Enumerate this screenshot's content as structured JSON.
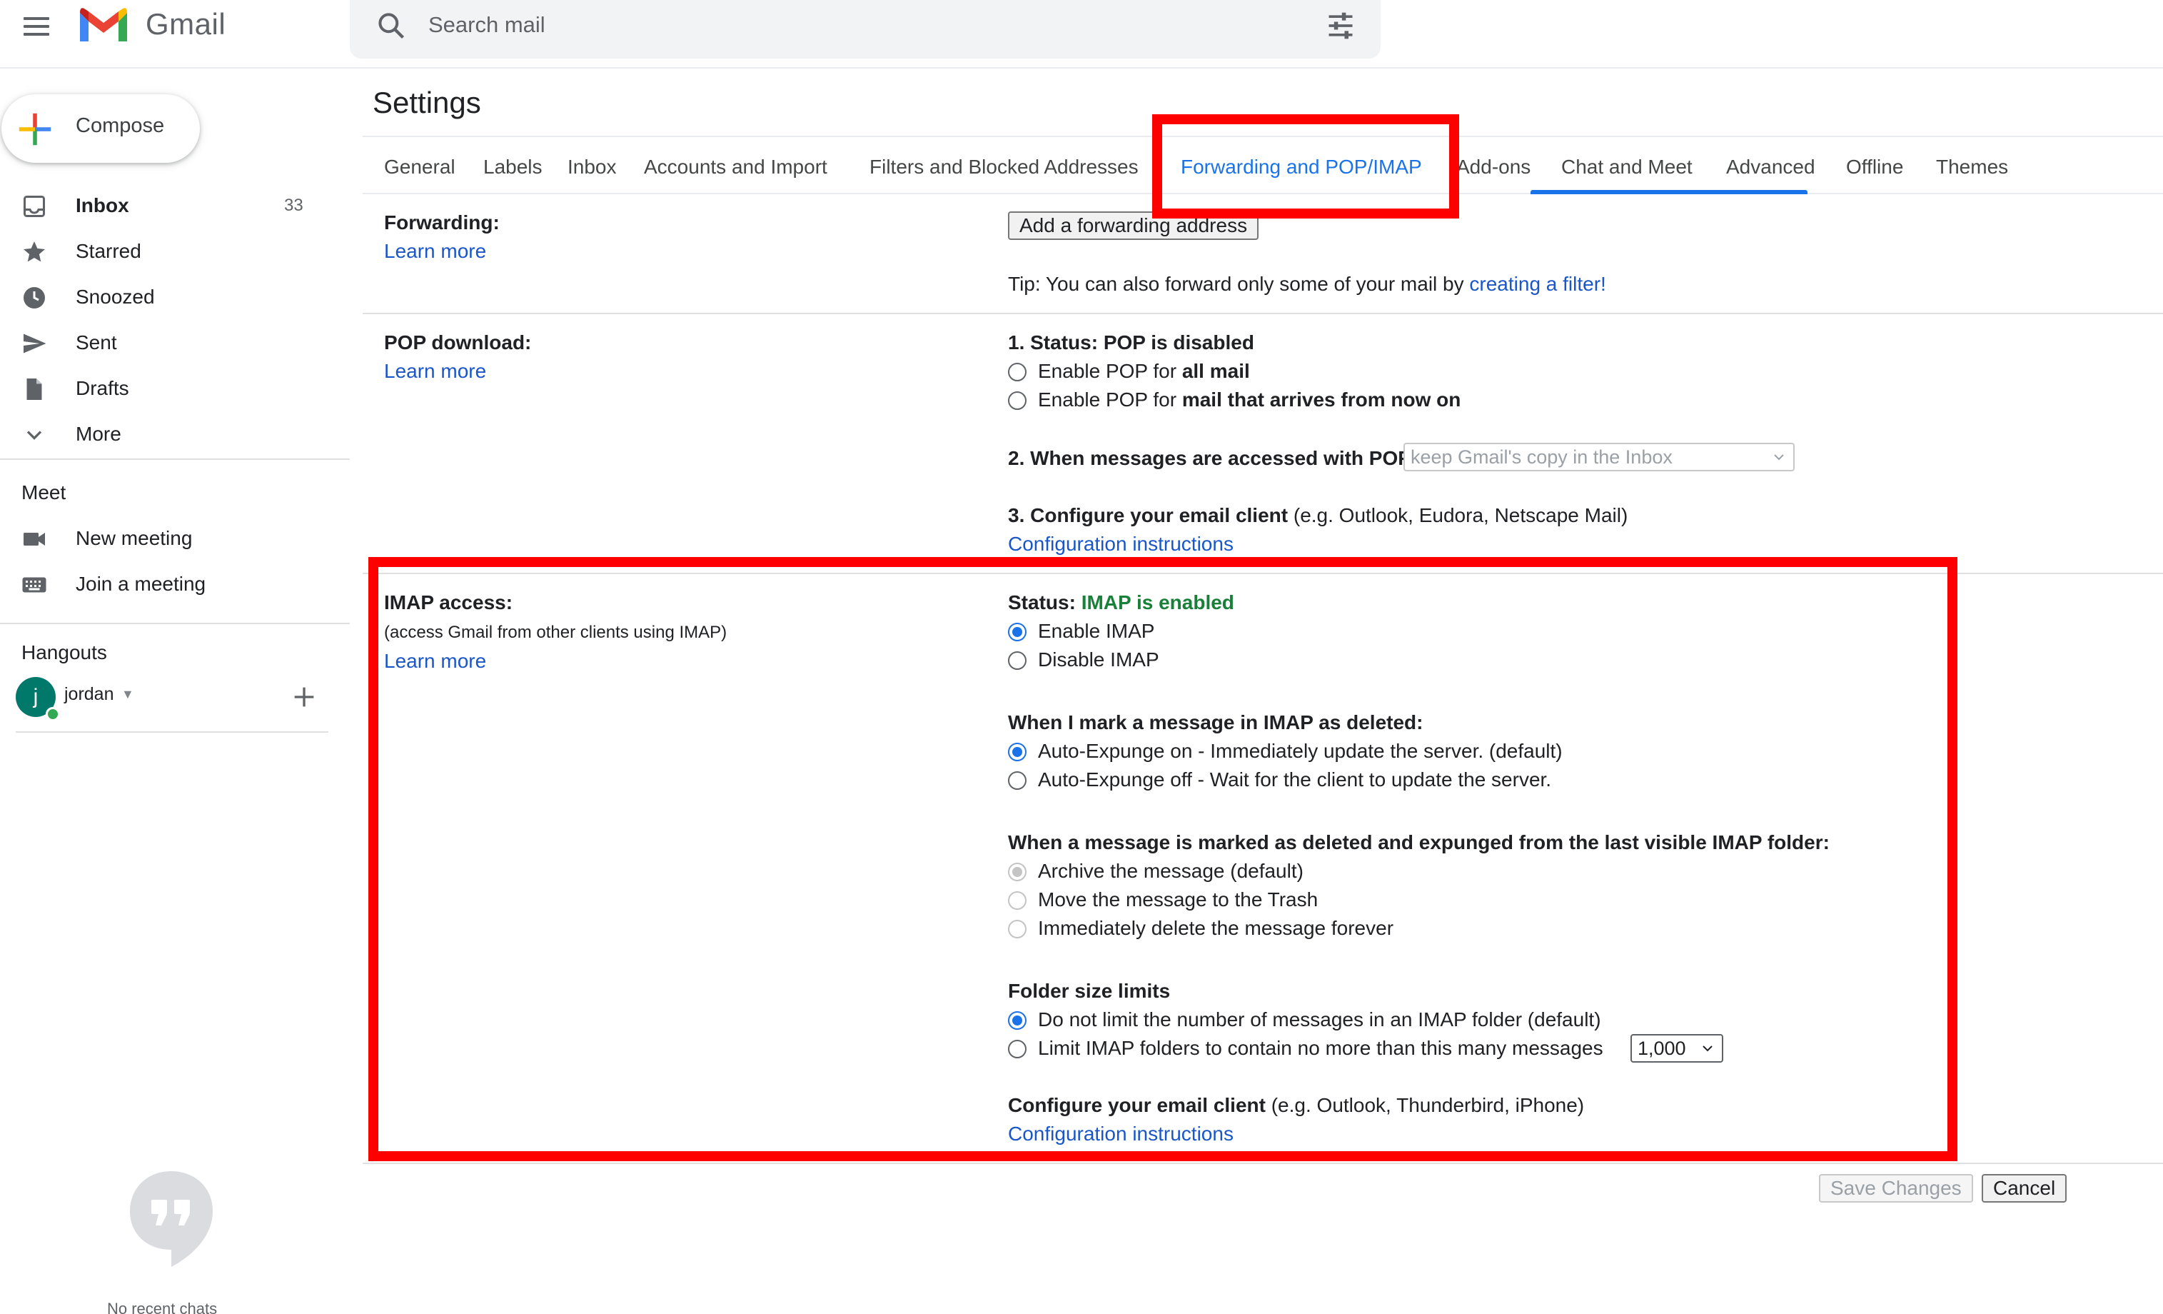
{
  "app": {
    "name": "Gmail"
  },
  "search": {
    "placeholder": "Search mail"
  },
  "sidebar": {
    "compose_label": "Compose",
    "items": [
      {
        "label": "Inbox",
        "count": "33",
        "icon": "inbox-icon"
      },
      {
        "label": "Starred",
        "icon": "star-icon"
      },
      {
        "label": "Snoozed",
        "icon": "clock-icon"
      },
      {
        "label": "Sent",
        "icon": "send-icon"
      },
      {
        "label": "Drafts",
        "icon": "draft-icon"
      },
      {
        "label": "More",
        "icon": "chevron-down-icon"
      }
    ],
    "meet": {
      "title": "Meet",
      "items": [
        {
          "label": "New meeting",
          "icon": "video-icon"
        },
        {
          "label": "Join a meeting",
          "icon": "keyboard-icon"
        }
      ]
    },
    "hangouts": {
      "title": "Hangouts",
      "user_initial": "j",
      "user_name": "jordan",
      "no_chats": "No recent chats"
    }
  },
  "settings": {
    "title": "Settings",
    "tabs": [
      "General",
      "Labels",
      "Inbox",
      "Accounts and Import",
      "Filters and Blocked Addresses",
      "Forwarding and POP/IMAP",
      "Add-ons",
      "Chat and Meet",
      "Advanced",
      "Offline",
      "Themes"
    ],
    "active_tab": "Forwarding and POP/IMAP",
    "learn_more": "Learn more",
    "forwarding": {
      "label": "Forwarding:",
      "button": "Add a forwarding address",
      "tip_prefix": "Tip: You can also forward only some of your mail by ",
      "tip_link": "creating a filter!"
    },
    "pop": {
      "label": "POP download:",
      "status_prefix": "1. Status: ",
      "status_value": "POP is disabled",
      "option1_prefix": "Enable POP for ",
      "option1_bold": "all mail",
      "option2_prefix": "Enable POP for ",
      "option2_bold": "mail that arrives from now on",
      "when_label": "2. When messages are accessed with POP",
      "when_select": "keep Gmail's copy in the Inbox",
      "configure_bold": "3. Configure your email client",
      "configure_rest": " (e.g. Outlook, Eudora, Netscape Mail)",
      "config_link": "Configuration instructions"
    },
    "imap": {
      "label": "IMAP access:",
      "sublabel": "(access Gmail from other clients using IMAP)",
      "status_prefix": "Status: ",
      "status_value": "IMAP is enabled",
      "enable": "Enable IMAP",
      "disable": "Disable IMAP",
      "deleted_heading": "When I mark a message in IMAP as deleted:",
      "expunge_on": "Auto-Expunge on - Immediately update the server. (default)",
      "expunge_off": "Auto-Expunge off - Wait for the client to update the server.",
      "expunged_heading": "When a message is marked as deleted and expunged from the last visible IMAP folder:",
      "archive": "Archive the message (default)",
      "trash": "Move the message to the Trash",
      "delete_forever": "Immediately delete the message forever",
      "folder_heading": "Folder size limits",
      "no_limit": "Do not limit the number of messages in an IMAP folder (default)",
      "limit": "Limit IMAP folders to contain no more than this many messages",
      "limit_value": "1,000",
      "configure_bold": "Configure your email client",
      "configure_rest": " (e.g. Outlook, Thunderbird, iPhone)",
      "config_link": "Configuration instructions"
    },
    "save_label": "Save Changes",
    "cancel_label": "Cancel"
  },
  "colors": {
    "accent": "#1a73e8",
    "highlight": "#ff0000",
    "enabled_green": "#188038"
  }
}
